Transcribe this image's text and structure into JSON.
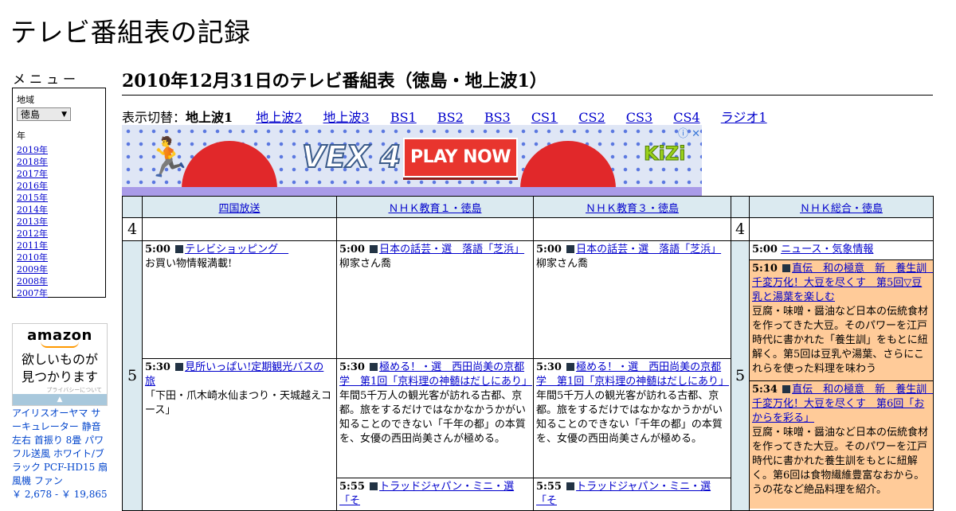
{
  "site": {
    "title": "テレビ番組表の記録"
  },
  "sidebar": {
    "menu_label": "メニュー",
    "region_label": "地域",
    "region_value": "徳島",
    "year_label": "年",
    "years": [
      "2019年",
      "2018年",
      "2017年",
      "2016年",
      "2015年",
      "2014年",
      "2013年",
      "2012年",
      "2011年",
      "2010年",
      "2009年",
      "2008年",
      "2007年"
    ]
  },
  "amazon_ad": {
    "logo": "amazon",
    "tagline_1": "欲しいものが",
    "tagline_2": "見つかります",
    "privacy": "プライバシーについて",
    "product_name": "アイリスオーヤマ サーキュレーター 静音 左右 首振り 8畳 パワフル送風 ホワイト/ブラック PCF-HD15 扇風機 ファン",
    "product_price": "￥ 2,678 - ￥ 19,865"
  },
  "main": {
    "page_title": "2010年12月31日のテレビ番組表（徳島・地上波1）",
    "switch_label": "表示切替：",
    "current_tab": "地上波1",
    "tabs": [
      "地上波2",
      "地上波3",
      "BS1",
      "BS2",
      "BS3",
      "CS1",
      "CS2",
      "CS3",
      "CS4",
      "ラジオ1"
    ]
  },
  "banner_ad": {
    "play_label": "PLAY NOW",
    "game_logo": "VEX 4",
    "brand": "KiZi",
    "info_icon": "info-icon",
    "close_icon": "close-icon"
  },
  "schedule": {
    "channels": [
      "四国放送",
      "ＮＨＫ教育１・徳島",
      "ＮＨＫ教育３・徳島",
      "ＮＨＫ総合・徳島"
    ],
    "hours": [
      "4",
      "5"
    ],
    "colors": {
      "header_bg": "#dbeaf0",
      "highlight": "#ffcb99"
    },
    "columns": [
      [
        {
          "time": "5:00",
          "title": "テレビショッピング　",
          "desc": "お買い物情報満載!"
        },
        {
          "time": "5:30",
          "title": "見所いっぱい!定期観光バスの旅",
          "desc": "「下田・爪木崎水仙まつり・天城越えコース」"
        }
      ],
      [
        {
          "time": "5:00",
          "title": "日本の話芸・選　落語「芝浜」",
          "desc": "柳家さん喬"
        },
        {
          "time": "5:30",
          "title": "極める！・選　西田尚美の京都学　第1回「京料理の神髄はだしにあり」",
          "desc": "年間5千万人の観光客が訪れる古都、京都。旅をするだけではなかなかうかがい知ることのできない「千年の都」の本質を、女優の西田尚美さんが極める。"
        },
        {
          "time": "5:55",
          "title": "トラッドジャパン・ミニ・選「そ",
          "desc": ""
        }
      ],
      [
        {
          "time": "5:00",
          "title": "日本の話芸・選　落語「芝浜」",
          "desc": "柳家さん喬"
        },
        {
          "time": "5:30",
          "title": "極める！・選　西田尚美の京都学　第1回「京料理の神髄はだしにあり」",
          "desc": "年間5千万人の観光客が訪れる古都、京都。旅をするだけではなかなかうかがい知ることのできない「千年の都」の本質を、女優の西田尚美さんが極める。"
        },
        {
          "time": "5:55",
          "title": "トラッドジャパン・ミニ・選「そ",
          "desc": ""
        }
      ],
      [
        {
          "time": "5:00",
          "title": "ニュース・気象情報",
          "desc": ""
        },
        {
          "time": "5:10",
          "title": "直伝　和の極意　新　養生訓　千変万化！大豆を尽くす　第5回▽豆乳と湯葉を楽しむ",
          "desc": "豆腐・味噌・醤油など日本の伝統食材を作ってきた大豆。そのパワーを江戸時代に書かれた「養生訓」をもとに紐解く。第5回は豆乳や湯葉、さらにこれらを使った料理を味わう"
        },
        {
          "time": "5:34",
          "title": "直伝　和の極意　新　養生訓　千変万化！大豆を尽くす　第6回「おからを彩る」",
          "desc": "豆腐・味噌・醤油など日本の伝統食材を作ってきた大豆。そのパワーを江戸時代に書かれた養生訓をもとに紐解く。第6回は食物繊維豊富なおから。うの花など絶品料理を紹介。"
        }
      ]
    ]
  }
}
